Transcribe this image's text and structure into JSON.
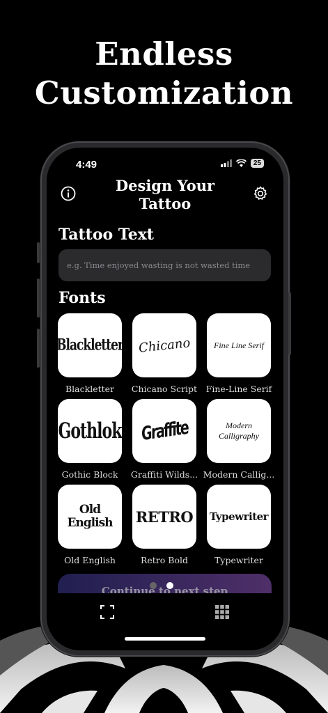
{
  "headline": {
    "line1": "Endless",
    "line2": "Customization"
  },
  "status": {
    "time": "4:49",
    "battery": "25"
  },
  "header": {
    "title_line1": "Design Your",
    "title_line2": "Tattoo"
  },
  "tattoo_text": {
    "title": "Tattoo Text",
    "placeholder": "e.g. Time enjoyed wasting is not wasted time"
  },
  "fonts": {
    "title": "Fonts",
    "items": [
      {
        "label": "Blackletter",
        "sample": "Blackletter"
      },
      {
        "label": "Chicano Script",
        "sample": "Chicano"
      },
      {
        "label": "Fine-Line Serif",
        "sample": "Fine Line Serif"
      },
      {
        "label": "Gothic Block",
        "sample": "Gothlok"
      },
      {
        "label": "Graffiti Wilds...",
        "sample": "Graffite"
      },
      {
        "label": "Modern Callig...",
        "sample": "Modern Calligraphy"
      },
      {
        "label": "Old English",
        "sample": "Old English"
      },
      {
        "label": "Retro Bold",
        "sample": "RETRO"
      },
      {
        "label": "Typewriter",
        "sample": "Typewriter"
      }
    ]
  },
  "continue_label": "Continue to next step",
  "pager": {
    "count": 2,
    "active": 1
  },
  "icons": {
    "info": "info-icon",
    "settings": "gear-icon",
    "scan": "scan-icon",
    "grid": "grid-icon"
  }
}
